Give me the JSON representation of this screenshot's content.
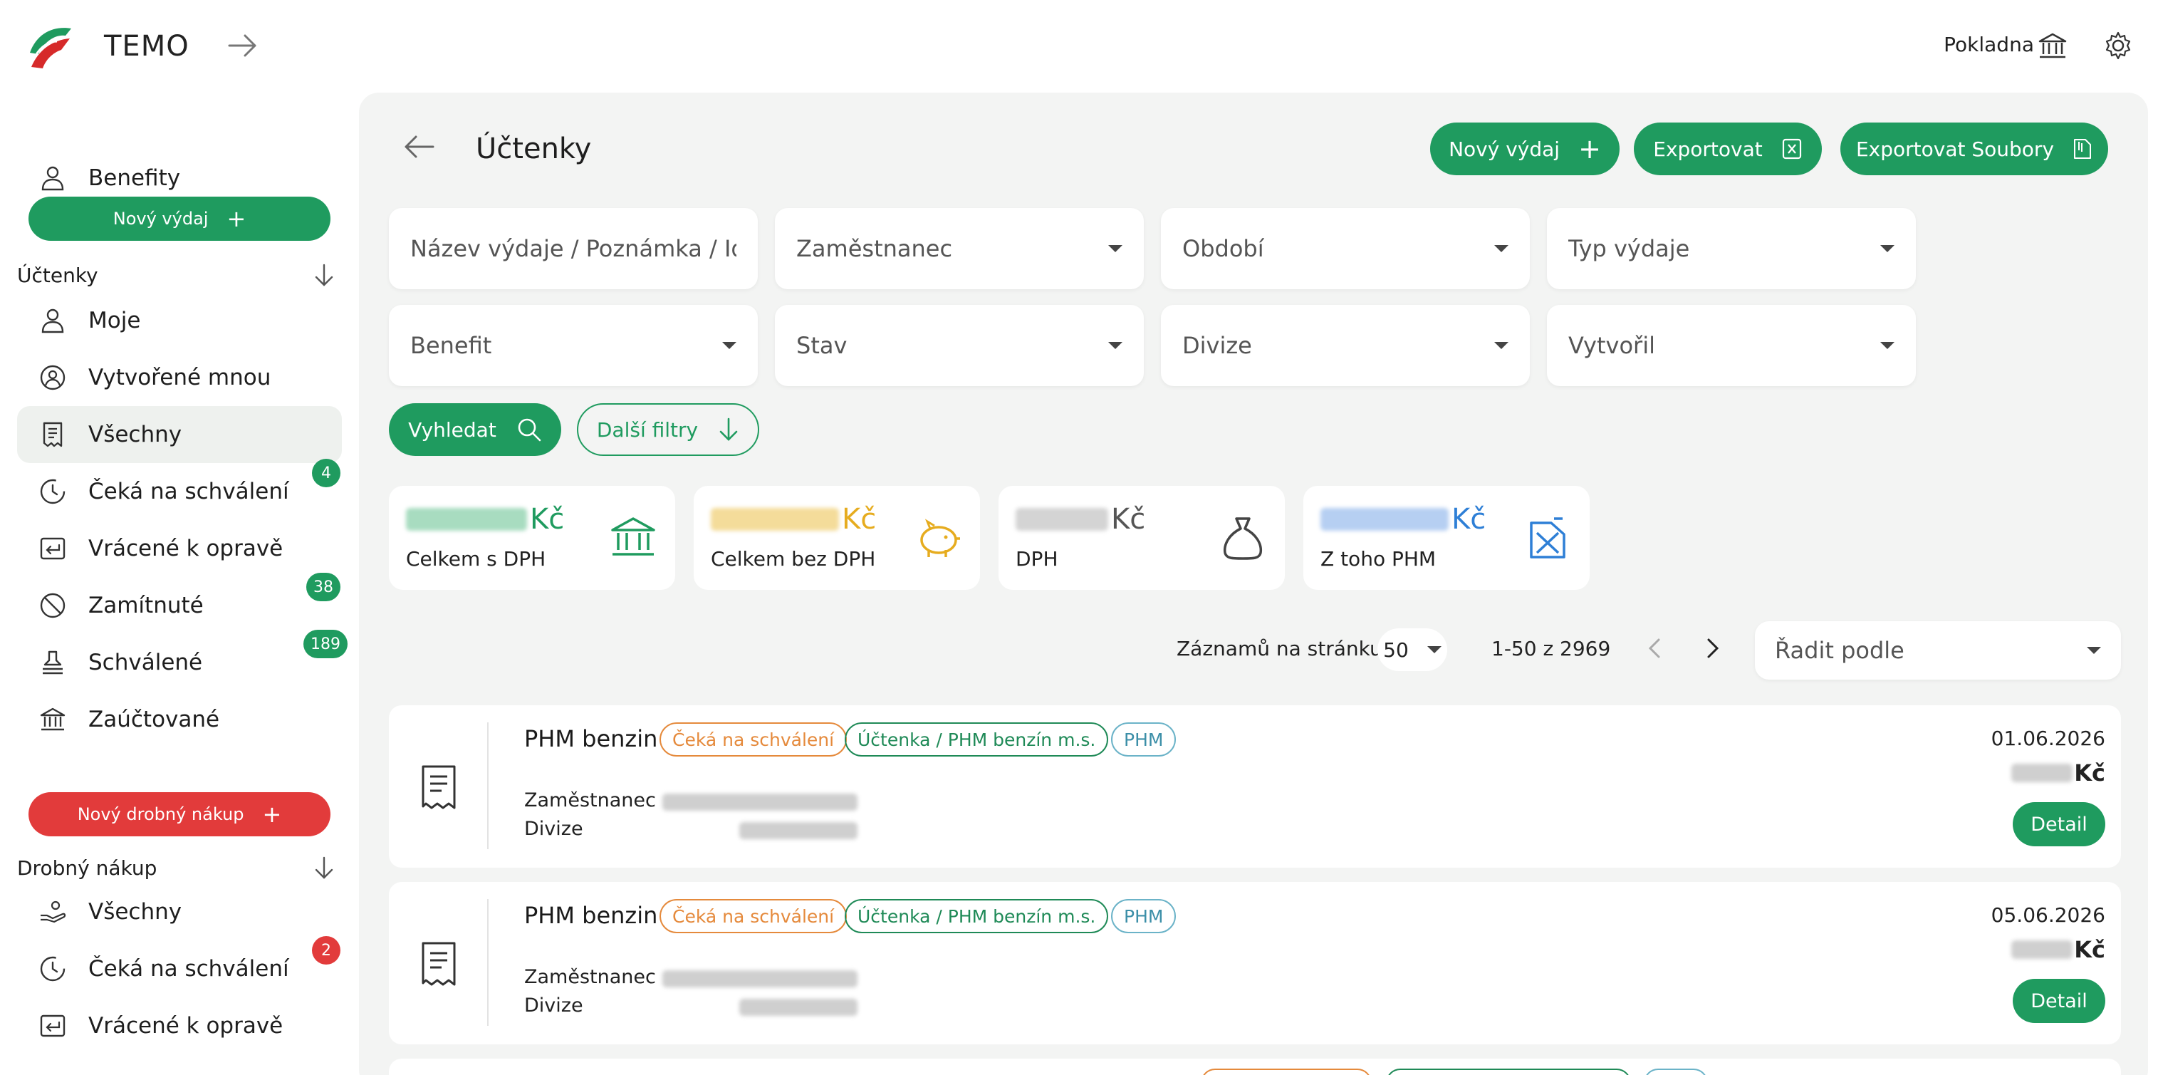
{
  "header": {
    "app_title": "TEMO",
    "pokladna_label": "Pokladna"
  },
  "sidebar": {
    "benefity_label": "Benefity",
    "new_expense_button": "Nový výdaj",
    "uctenky_section": "Účtenky",
    "items": [
      {
        "label": "Moje"
      },
      {
        "label": "Vytvořené mnou"
      },
      {
        "label": "Všechny"
      },
      {
        "label": "Čeká na schválení",
        "badge": "4"
      },
      {
        "label": "Vrácené k opravě"
      },
      {
        "label": "Zamítnuté",
        "badge": "38"
      },
      {
        "label": "Schválené",
        "badge": "189"
      },
      {
        "label": "Zaúčtované"
      }
    ],
    "new_small_purchase_button": "Nový drobný nákup",
    "drobny_section": "Drobný nákup",
    "drobny_items": [
      {
        "label": "Všechny"
      },
      {
        "label": "Čeká na schválení",
        "badge": "2"
      },
      {
        "label": "Vrácené k opravě"
      }
    ]
  },
  "main": {
    "title": "Účtenky",
    "buttons": {
      "new_expense": "Nový výdaj",
      "export": "Exportovat",
      "export_files": "Exportovat Soubory"
    },
    "filters": {
      "name": "Název výdaje / Poznámka / Ide...",
      "employee": "Zaměstnanec",
      "period": "Období",
      "expense_type": "Typ výdaje",
      "benefit": "Benefit",
      "status": "Stav",
      "division": "Divize",
      "created_by": "Vytvořil"
    },
    "search_button": "Vyhledat",
    "more_filters_button": "Další filtry",
    "summary": [
      {
        "caption": "Celkem s DPH",
        "currency": "Kč",
        "color": "#1f9b5f"
      },
      {
        "caption": "Celkem bez DPH",
        "currency": "Kč",
        "color": "#e6ac1f"
      },
      {
        "caption": "DPH",
        "currency": "Kč",
        "color": "#555555"
      },
      {
        "caption": "Z toho PHM",
        "currency": "Kč",
        "color": "#2e7fd6"
      }
    ],
    "pagination": {
      "per_page_label": "Záznamů na stránku:",
      "per_page_value": "50",
      "range": "1-50 z 2969"
    },
    "sort_placeholder": "Řadit podle",
    "rows": [
      {
        "title": "PHM benzin",
        "status_tag": "Čeká na schválení",
        "type_tag": "Účtenka / PHM benzín m.s.",
        "category_tag": "PHM",
        "employee_label": "Zaměstnanec",
        "division_label": "Divize",
        "date": "01.06.2026",
        "currency": "Kč",
        "detail_button": "Detail"
      },
      {
        "title": "PHM benzin",
        "status_tag": "Čeká na schválení",
        "type_tag": "Účtenka / PHM benzín m.s.",
        "category_tag": "PHM",
        "employee_label": "Zaměstnanec",
        "division_label": "Divize",
        "date": "05.06.2026",
        "currency": "Kč",
        "detail_button": "Detail"
      }
    ]
  }
}
